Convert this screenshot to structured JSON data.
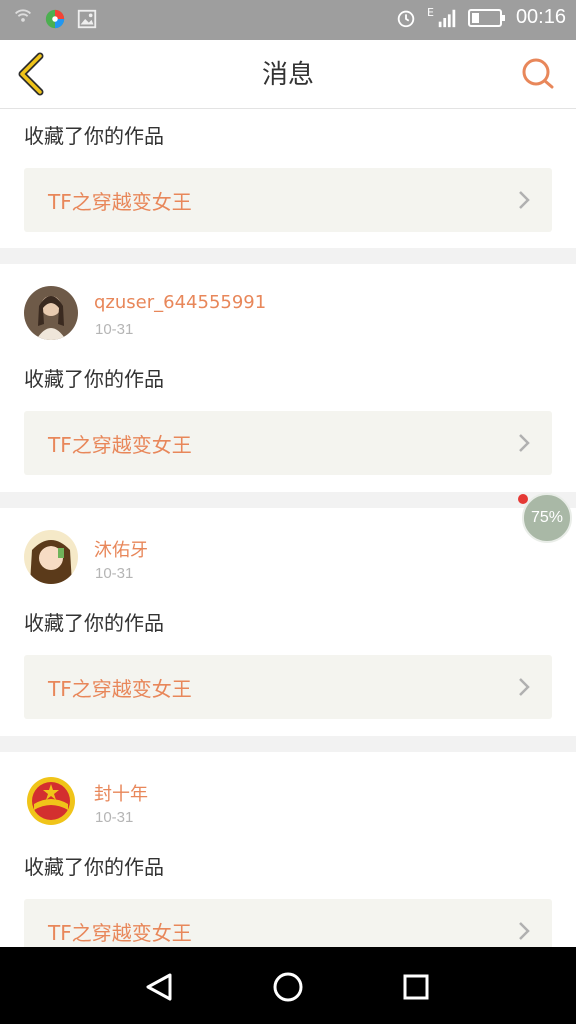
{
  "status_bar": {
    "time": "00:16",
    "icons": [
      "wifi-hotspot-icon",
      "app-icon",
      "gallery-icon",
      "alarm-icon",
      "signal-icon",
      "battery-icon"
    ],
    "network_label": "E"
  },
  "header": {
    "title": "消息",
    "back_icon": "chevron-left-icon",
    "search_icon": "search-icon"
  },
  "messages": [
    {
      "action": "收藏了你的作品",
      "work_title": "TF之穿越变女王"
    },
    {
      "username": "qzuser_644555991",
      "date": "10-31",
      "action": "收藏了你的作品",
      "work_title": "TF之穿越变女王"
    },
    {
      "username": "沐佑牙",
      "date": "10-31",
      "action": "收藏了你的作品",
      "work_title": "TF之穿越变女王"
    },
    {
      "username": "封十年",
      "date": "10-31",
      "action": "收藏了你的作品",
      "work_title": "TF之穿越变女王"
    }
  ],
  "floating_badge": {
    "label": "75%"
  },
  "colors": {
    "accent": "#e8875a",
    "status_bar": "#9e9e9e",
    "card_link_bg": "#f4f4ef"
  }
}
